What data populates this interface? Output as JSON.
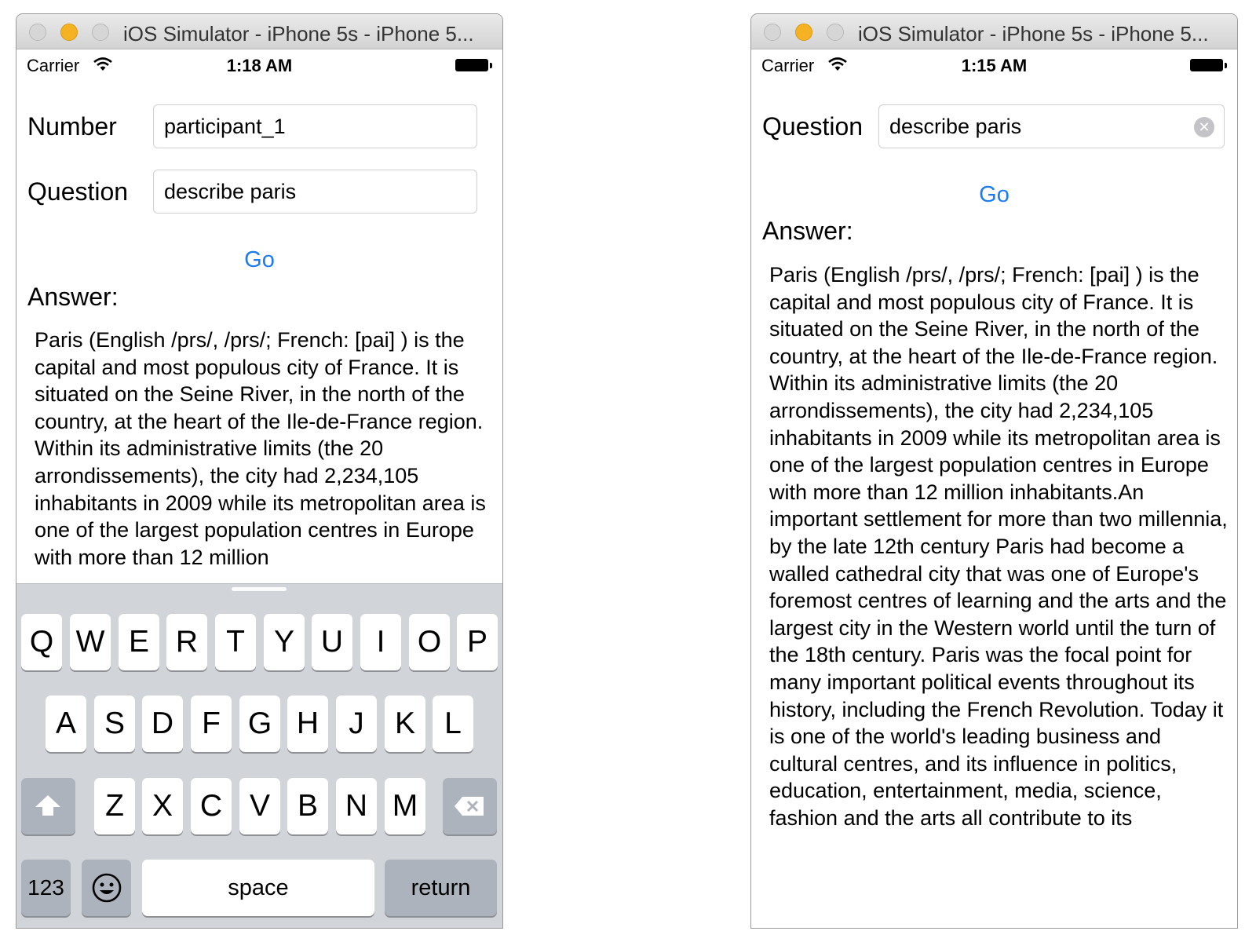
{
  "left": {
    "window_title": "iOS Simulator - iPhone 5s - iPhone 5...",
    "status": {
      "carrier": "Carrier",
      "time": "1:18 AM"
    },
    "number": {
      "label": "Number",
      "value": "participant_1"
    },
    "question": {
      "label": "Question",
      "value": "describe paris"
    },
    "go_label": "Go",
    "answer_label": "Answer:",
    "answer_text": "Paris (English /prs/, /prs/; French: [pai] ) is the capital and most populous city of France. It is situated on the Seine River, in the north of the country, at the heart of the Ile-de-France region. Within its administrative limits (the 20 arrondissements), the city had 2,234,105 inhabitants in 2009 while its metropolitan area is one of the largest population centres in Europe with more than 12 million",
    "keyboard": {
      "row1": [
        "Q",
        "W",
        "E",
        "R",
        "T",
        "Y",
        "U",
        "I",
        "O",
        "P"
      ],
      "row2": [
        "A",
        "S",
        "D",
        "F",
        "G",
        "H",
        "J",
        "K",
        "L"
      ],
      "row3": [
        "Z",
        "X",
        "C",
        "V",
        "B",
        "N",
        "M"
      ],
      "numbers_label": "123",
      "space_label": "space",
      "return_label": "return"
    }
  },
  "right": {
    "window_title": "iOS Simulator - iPhone 5s - iPhone 5...",
    "status": {
      "carrier": "Carrier",
      "time": "1:15 AM"
    },
    "question": {
      "label": "Question",
      "value": "describe paris"
    },
    "go_label": "Go",
    "answer_label": "Answer:",
    "answer_text": "Paris (English /prs/, /prs/; French: [pai] ) is the capital and most populous city of France. It is situated on the Seine River, in the north of the country, at the heart of the Ile-de-France region. Within its administrative limits (the 20 arrondissements), the city had 2,234,105 inhabitants in 2009 while its metropolitan area is one of the largest population centres in Europe with more than 12 million inhabitants.An important settlement for more than two millennia, by the late 12th century Paris had become a walled cathedral city that was one of Europe's foremost centres of learning and the arts and the largest city in the Western world until the turn of the 18th century. Paris was the focal point for many important political events throughout its history, including the French Revolution. Today it is one of the world's leading business and cultural centres, and its influence in politics, education, entertainment, media, science, fashion and the arts all contribute to its"
  }
}
